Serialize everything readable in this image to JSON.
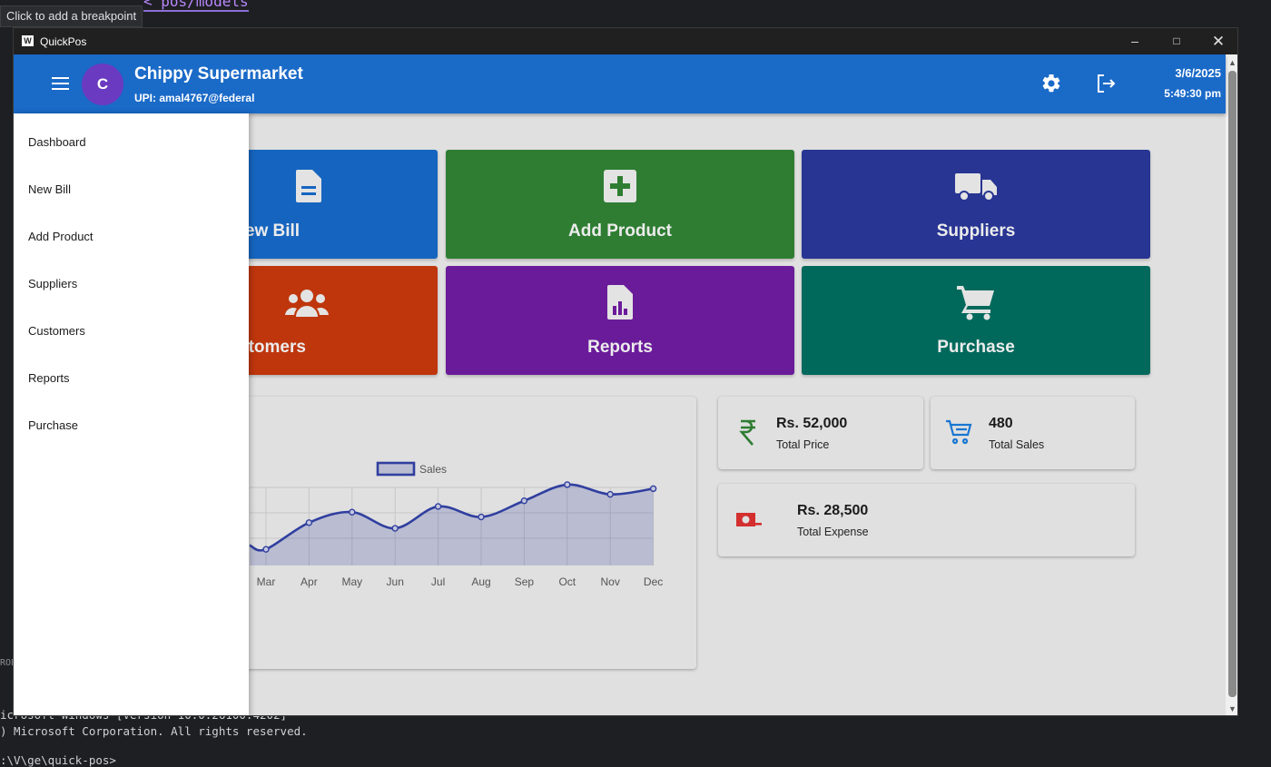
{
  "ide": {
    "tooltip": "Click to add a breakpoint",
    "code_snippet": "< pos/models",
    "term_label": "ROE",
    "terminal_lines": [
      "icrosoft Windows [Version 10.0.26100.4202]",
      ") Microsoft Corporation. All rights reserved.",
      "",
      ":\\V\\ge\\quick-pos>"
    ]
  },
  "window": {
    "title": "QuickPos",
    "icon": "w-app-icon",
    "controls": [
      "minimize-icon",
      "maximize-icon",
      "close-icon"
    ]
  },
  "appbar": {
    "avatar_letter": "C",
    "store_name": "Chippy Supermarket",
    "upi": "UPI: amal4767@federal",
    "date": "3/6/2025",
    "time": "5:49:30 pm",
    "icons": [
      "menu-icon",
      "settings-icon",
      "logout-icon"
    ]
  },
  "drawer": {
    "items": [
      "Dashboard",
      "New Bill",
      "Add Product",
      "Suppliers",
      "Customers",
      "Reports",
      "Purchase"
    ]
  },
  "tiles": [
    {
      "label": "ew Bill",
      "color": "#1565c0",
      "icon": "file-icon"
    },
    {
      "label": "Add Product",
      "color": "#2e7d32",
      "icon": "plus-box-icon"
    },
    {
      "label": "Suppliers",
      "color": "#283593",
      "icon": "truck-icon"
    },
    {
      "label": "stomers",
      "color": "#bf360c",
      "icon": "users-icon"
    },
    {
      "label": "Reports",
      "color": "#6a1b9a",
      "icon": "report-icon"
    },
    {
      "label": "Purchase",
      "color": "#00695c",
      "icon": "cart-icon"
    }
  ],
  "stats": {
    "total_price": {
      "value": "Rs. 52,000",
      "label": "Total Price",
      "icon": "rupee-icon",
      "color": "#2e7d32"
    },
    "total_sales": {
      "value": "480",
      "label": "Total Sales",
      "icon": "cart-icon",
      "color": "#1976d2"
    },
    "total_expense": {
      "value": "Rs. 28,500",
      "label": "Total Expense",
      "icon": "money-icon",
      "color": "#d32f2f"
    }
  },
  "chart_data": {
    "type": "line",
    "series": [
      {
        "name": "Sales",
        "color": "#303f9f"
      }
    ],
    "categories": [
      "Mar",
      "Apr",
      "May",
      "Jun",
      "Jul",
      "Aug",
      "Sep",
      "Oct",
      "Nov",
      "Dec"
    ],
    "values": [
      2,
      5.3,
      6.6,
      4.6,
      7.3,
      6,
      8,
      10,
      8.8,
      9.5
    ],
    "ylim": [
      0,
      11
    ],
    "grid": true,
    "fill": true
  }
}
